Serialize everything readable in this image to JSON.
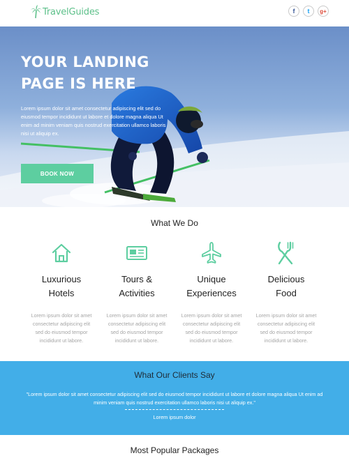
{
  "header": {
    "logo_text": "TravelGuides",
    "social": [
      {
        "glyph": "f",
        "icon": "facebook-icon"
      },
      {
        "glyph": "t",
        "icon": "twitter-icon"
      },
      {
        "glyph": "g+",
        "icon": "google-plus-icon"
      }
    ]
  },
  "hero": {
    "title_line1": "YOUR LANDING",
    "title_line2": "PAGE IS HERE",
    "text": "Lorem ipsum dolor sit amet consectetur adipiscing elit sed do eiusmod tempor incididunt ut labore et dolore magna aliqua Ut enim ad minim veniam quis nostrud exercitation ullamco laboris nisi ut aliquip ex.",
    "button_label": "BOOK NOW"
  },
  "what_we_do": {
    "title": "What We Do",
    "features": [
      {
        "name_line1": "Luxurious",
        "name_line2": "Hotels",
        "icon": "home-icon",
        "desc": "Lorem ipsum dolor sit amet consectetur adipiscing elit sed do eiusmod tempor incididunt ut labore."
      },
      {
        "name_line1": "Tours &",
        "name_line2": "Activities",
        "icon": "ticket-icon",
        "desc": "Lorem ipsum dolor sit amet consectetur adipiscing elit sed do eiusmod tempor incididunt ut labore."
      },
      {
        "name_line1": "Unique",
        "name_line2": "Experiences",
        "icon": "airplane-icon",
        "desc": "Lorem ipsum dolor sit amet consectetur adipiscing elit sed do eiusmod tempor incididunt ut labore."
      },
      {
        "name_line1": "Delicious",
        "name_line2": "Food",
        "icon": "fork-knife-icon",
        "desc": "Lorem ipsum dolor sit amet consectetur adipiscing elit sed do eiusmod tempor incididunt ut labore."
      }
    ]
  },
  "clients": {
    "title": "What Our Clients Say",
    "quote": "\"Lorem ipsum dolor sit amet consectetur adipiscing elit sed do eiusmod tempor incididunt ut labore et dolore magna aliqua Ut enim ad minim veniam quis nostrud exercitation ullamco laboris nisi ut aliquip ex.\"",
    "author": "Lorem ipsum dolor"
  },
  "popular": {
    "title": "Most Popular Packages"
  },
  "colors": {
    "brand_green": "#5dc08a",
    "button_green": "#5dcea0",
    "accent_blue": "#42aee8"
  }
}
